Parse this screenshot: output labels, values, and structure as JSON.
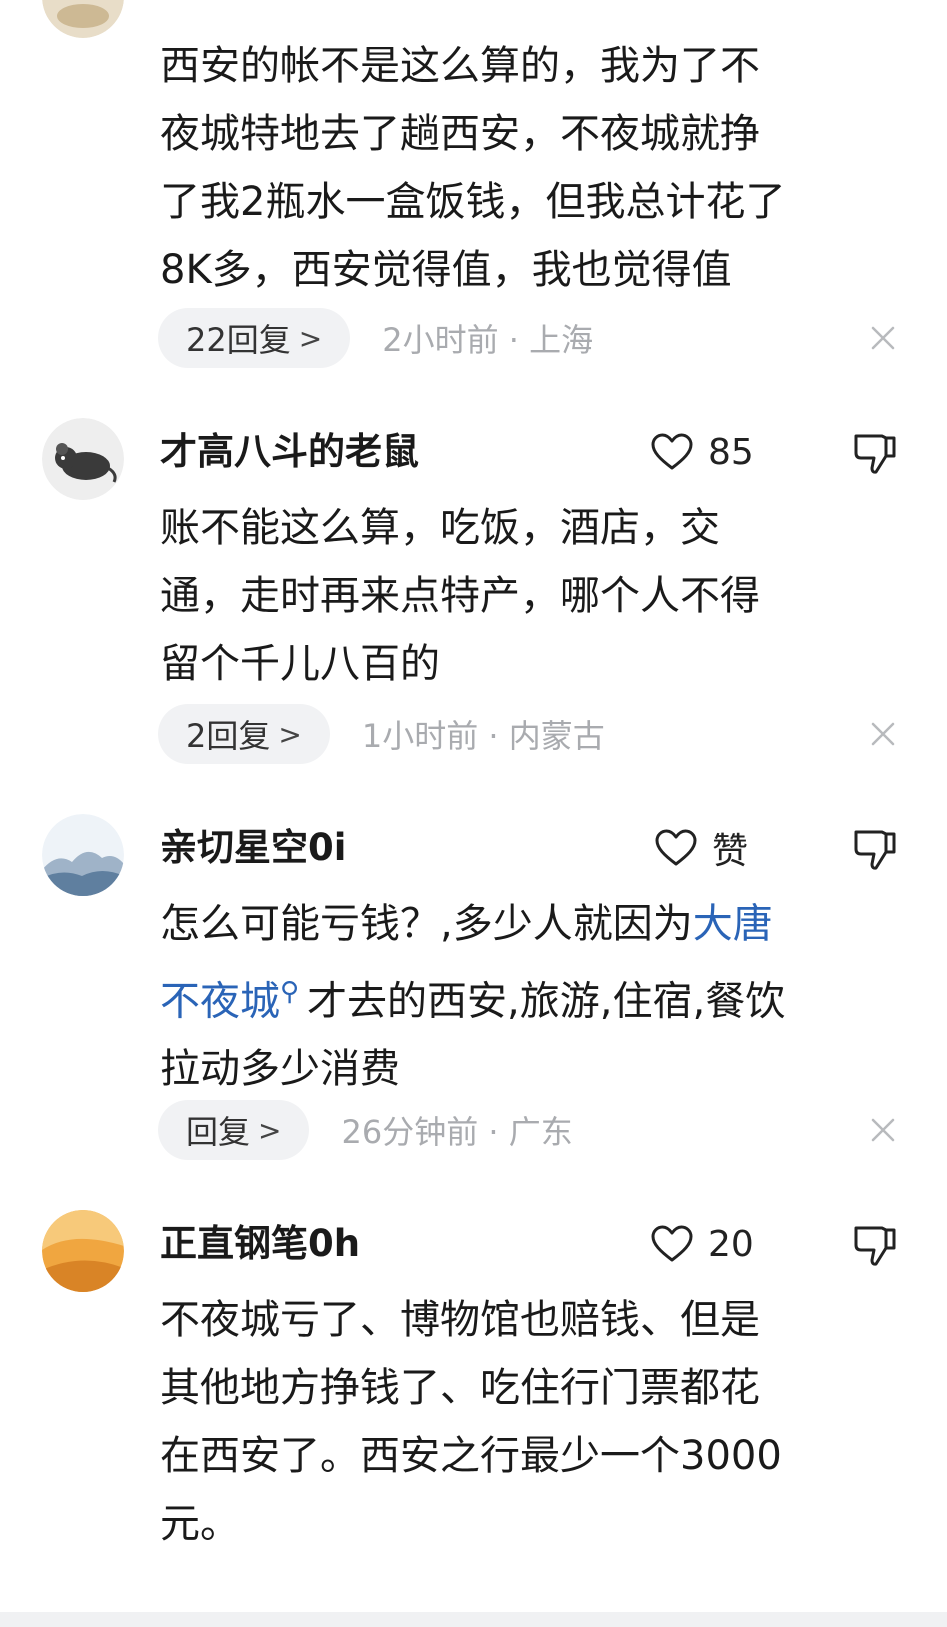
{
  "colors": {
    "link": "#2a64b7",
    "meta": "#a9abaf",
    "pill_bg": "#f1f2f4"
  },
  "icons": {
    "like": "heart-outline-icon",
    "dislike": "thumbs-down-outline-icon",
    "dismiss": "close-icon",
    "reply_arrow": "chevron-right-icon"
  },
  "comments": [
    {
      "id": "c0",
      "user": "",
      "likes": "",
      "text_lines": [
        "西安的帐不是这么算的，我为了不",
        "夜城特地去了趟西安，不夜城就挣",
        "了我2瓶水一盒饭钱，但我总计花了",
        "8K多，西安觉得值，我也觉得值"
      ],
      "reply_label": "22回复",
      "time": "2小时前",
      "location": "上海"
    },
    {
      "id": "c1",
      "user": "才高八斗的老鼠",
      "likes": "85",
      "text_lines": [
        "账不能这么算，吃饭，酒店，交",
        "通，走时再来点特产，哪个人不得",
        "留个千儿八百的"
      ],
      "reply_label": "2回复",
      "time": "1小时前",
      "location": "内蒙古"
    },
    {
      "id": "c2",
      "user": "亲切星空0i",
      "likes": "赞",
      "text_line1_pre": "怎么可能亏钱？,多少人就因为",
      "link_part1": "大唐",
      "link_part2": "不夜城",
      "text_line2_post": "才去的西安,旅游,住宿,餐饮",
      "text_line3": "拉动多少消费",
      "reply_label": "回复",
      "time": "26分钟前",
      "location": "广东"
    },
    {
      "id": "c3",
      "user": "正直钢笔0h",
      "likes": "20",
      "text_lines": [
        "不夜城亏了、博物馆也赔钱、但是",
        "其他地方挣钱了、吃住行门票都花",
        "在西安了。西安之行最少一个3000",
        "元。"
      ]
    }
  ]
}
